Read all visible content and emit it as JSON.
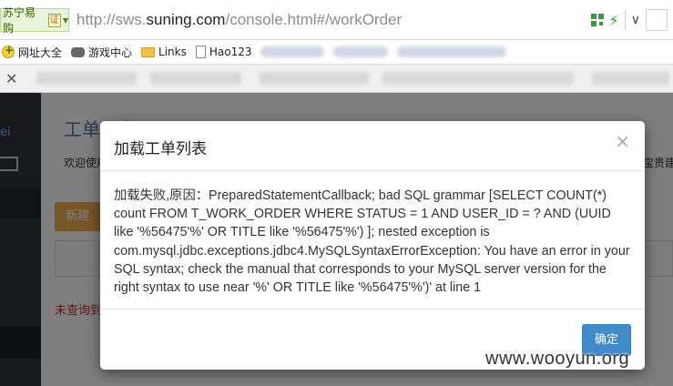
{
  "browser": {
    "site_badge": "苏宁易购",
    "cert_label": "证",
    "url_prefix": "http://sws.",
    "url_host": "suning.com",
    "url_path": "/console.html#/workOrder"
  },
  "bookmarks": [
    {
      "label": "网址大全",
      "icon": "home-plus-icon"
    },
    {
      "label": "游戏中心",
      "icon": "gamepad-icon"
    },
    {
      "label": "Links",
      "icon": "folder-icon"
    },
    {
      "label": "Hao123",
      "icon": "page-icon"
    }
  ],
  "page": {
    "side_text": "ei",
    "title": "工单与商品",
    "welcome": "欢迎使用",
    "welcome_right": "宝贵建",
    "new_button": "新建",
    "no_result": "未查询到"
  },
  "modal": {
    "title": "加载工单列表",
    "close": "×",
    "message": "加载失败,原因：PreparedStatementCallback; bad SQL grammar [SELECT COUNT(*) count FROM T_WORK_ORDER WHERE STATUS = 1 AND USER_ID = ? AND (UUID like '%56475'%' OR TITLE like '%56475'%') ]; nested exception is com.mysql.jdbc.exceptions.jdbc4.MySQLSyntaxErrorException: You have an error in your SQL syntax; check the manual that corresponds to your MySQL server version for the right syntax to use near '%' OR TITLE like '%56475'%')' at line 1",
    "ok_button": "确定"
  },
  "watermark": "www.wooyun.org",
  "colors": {
    "primary": "#428bca",
    "warning": "#f0ad4e",
    "danger": "#c9302c"
  }
}
